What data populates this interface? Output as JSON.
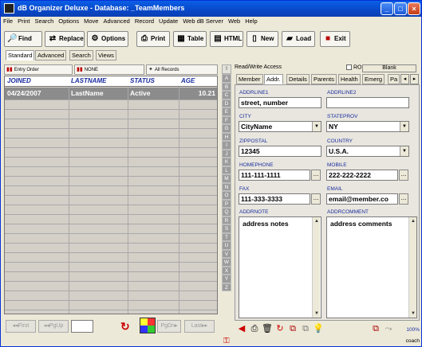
{
  "window": {
    "title": "dB Organizer Deluxe - Database: _TeamMembers"
  },
  "menu": [
    "File",
    "Print",
    "Search",
    "Options",
    "Move",
    "Advanced",
    "Record",
    "Update",
    "Web dB Server",
    "Web",
    "Help"
  ],
  "toolbar": {
    "find": "Find",
    "replace": "Replace",
    "options": "Options",
    "print": "Print",
    "table": "Table",
    "html": "HTML",
    "new": "New",
    "load": "Load",
    "exit": "Exit"
  },
  "view_tabs": [
    "Standard",
    "Advanced",
    "Search",
    "Views"
  ],
  "sort": {
    "entry_order": "Entry Order",
    "none": "NONE",
    "all_records": "All Records"
  },
  "grid": {
    "columns": [
      "JOINED",
      "LASTNAME",
      "STATUS",
      "AGE"
    ],
    "rows": [
      {
        "joined": "04/24/2007",
        "lastname": "LastName",
        "status": "Active",
        "age": "10.21"
      }
    ]
  },
  "nav": {
    "first": "First",
    "pgup": "PgUp",
    "pgdn": "PgDn",
    "last": "Last"
  },
  "alphabet": [
    "A",
    "B",
    "C",
    "D",
    "E",
    "F",
    "G",
    "H",
    "I",
    "J",
    "K",
    "L",
    "M",
    "N",
    "O",
    "P",
    "Q",
    "R",
    "S",
    "T",
    "U",
    "V",
    "W",
    "X",
    "Y",
    "Z"
  ],
  "access": {
    "label": "Read/Write Access",
    "ro": "RO",
    "blank": "Blank"
  },
  "form_tabs": [
    "Member",
    "Addr.",
    "Details",
    "Parents",
    "Health",
    "Emerg",
    "Pa"
  ],
  "fields": {
    "addrline1": {
      "label": "ADDRLINE1",
      "value": "street, number"
    },
    "addrline2": {
      "label": "ADDRLINE2",
      "value": ""
    },
    "city": {
      "label": "CITY",
      "value": "CityName"
    },
    "stateprov": {
      "label": "STATEPROV",
      "value": "NY"
    },
    "zippostal": {
      "label": "ZIPPOSTAL",
      "value": "12345"
    },
    "country": {
      "label": "COUNTRY",
      "value": "U.S.A."
    },
    "homephone": {
      "label": "HOMEPHONE",
      "value": "111-111-1111"
    },
    "mobile": {
      "label": "MOBILE",
      "value": "222-222-2222"
    },
    "fax": {
      "label": "FAX",
      "value": "111-333-3333"
    },
    "email": {
      "label": "EMAIL",
      "value": "email@member.co"
    },
    "addrnote": {
      "label": "ADDRNOTE",
      "value": "address notes"
    },
    "addrcomment": {
      "label": "ADDRCOMMENT",
      "value": "address comments"
    }
  },
  "status": {
    "zoom": "100%",
    "user": "coach"
  }
}
